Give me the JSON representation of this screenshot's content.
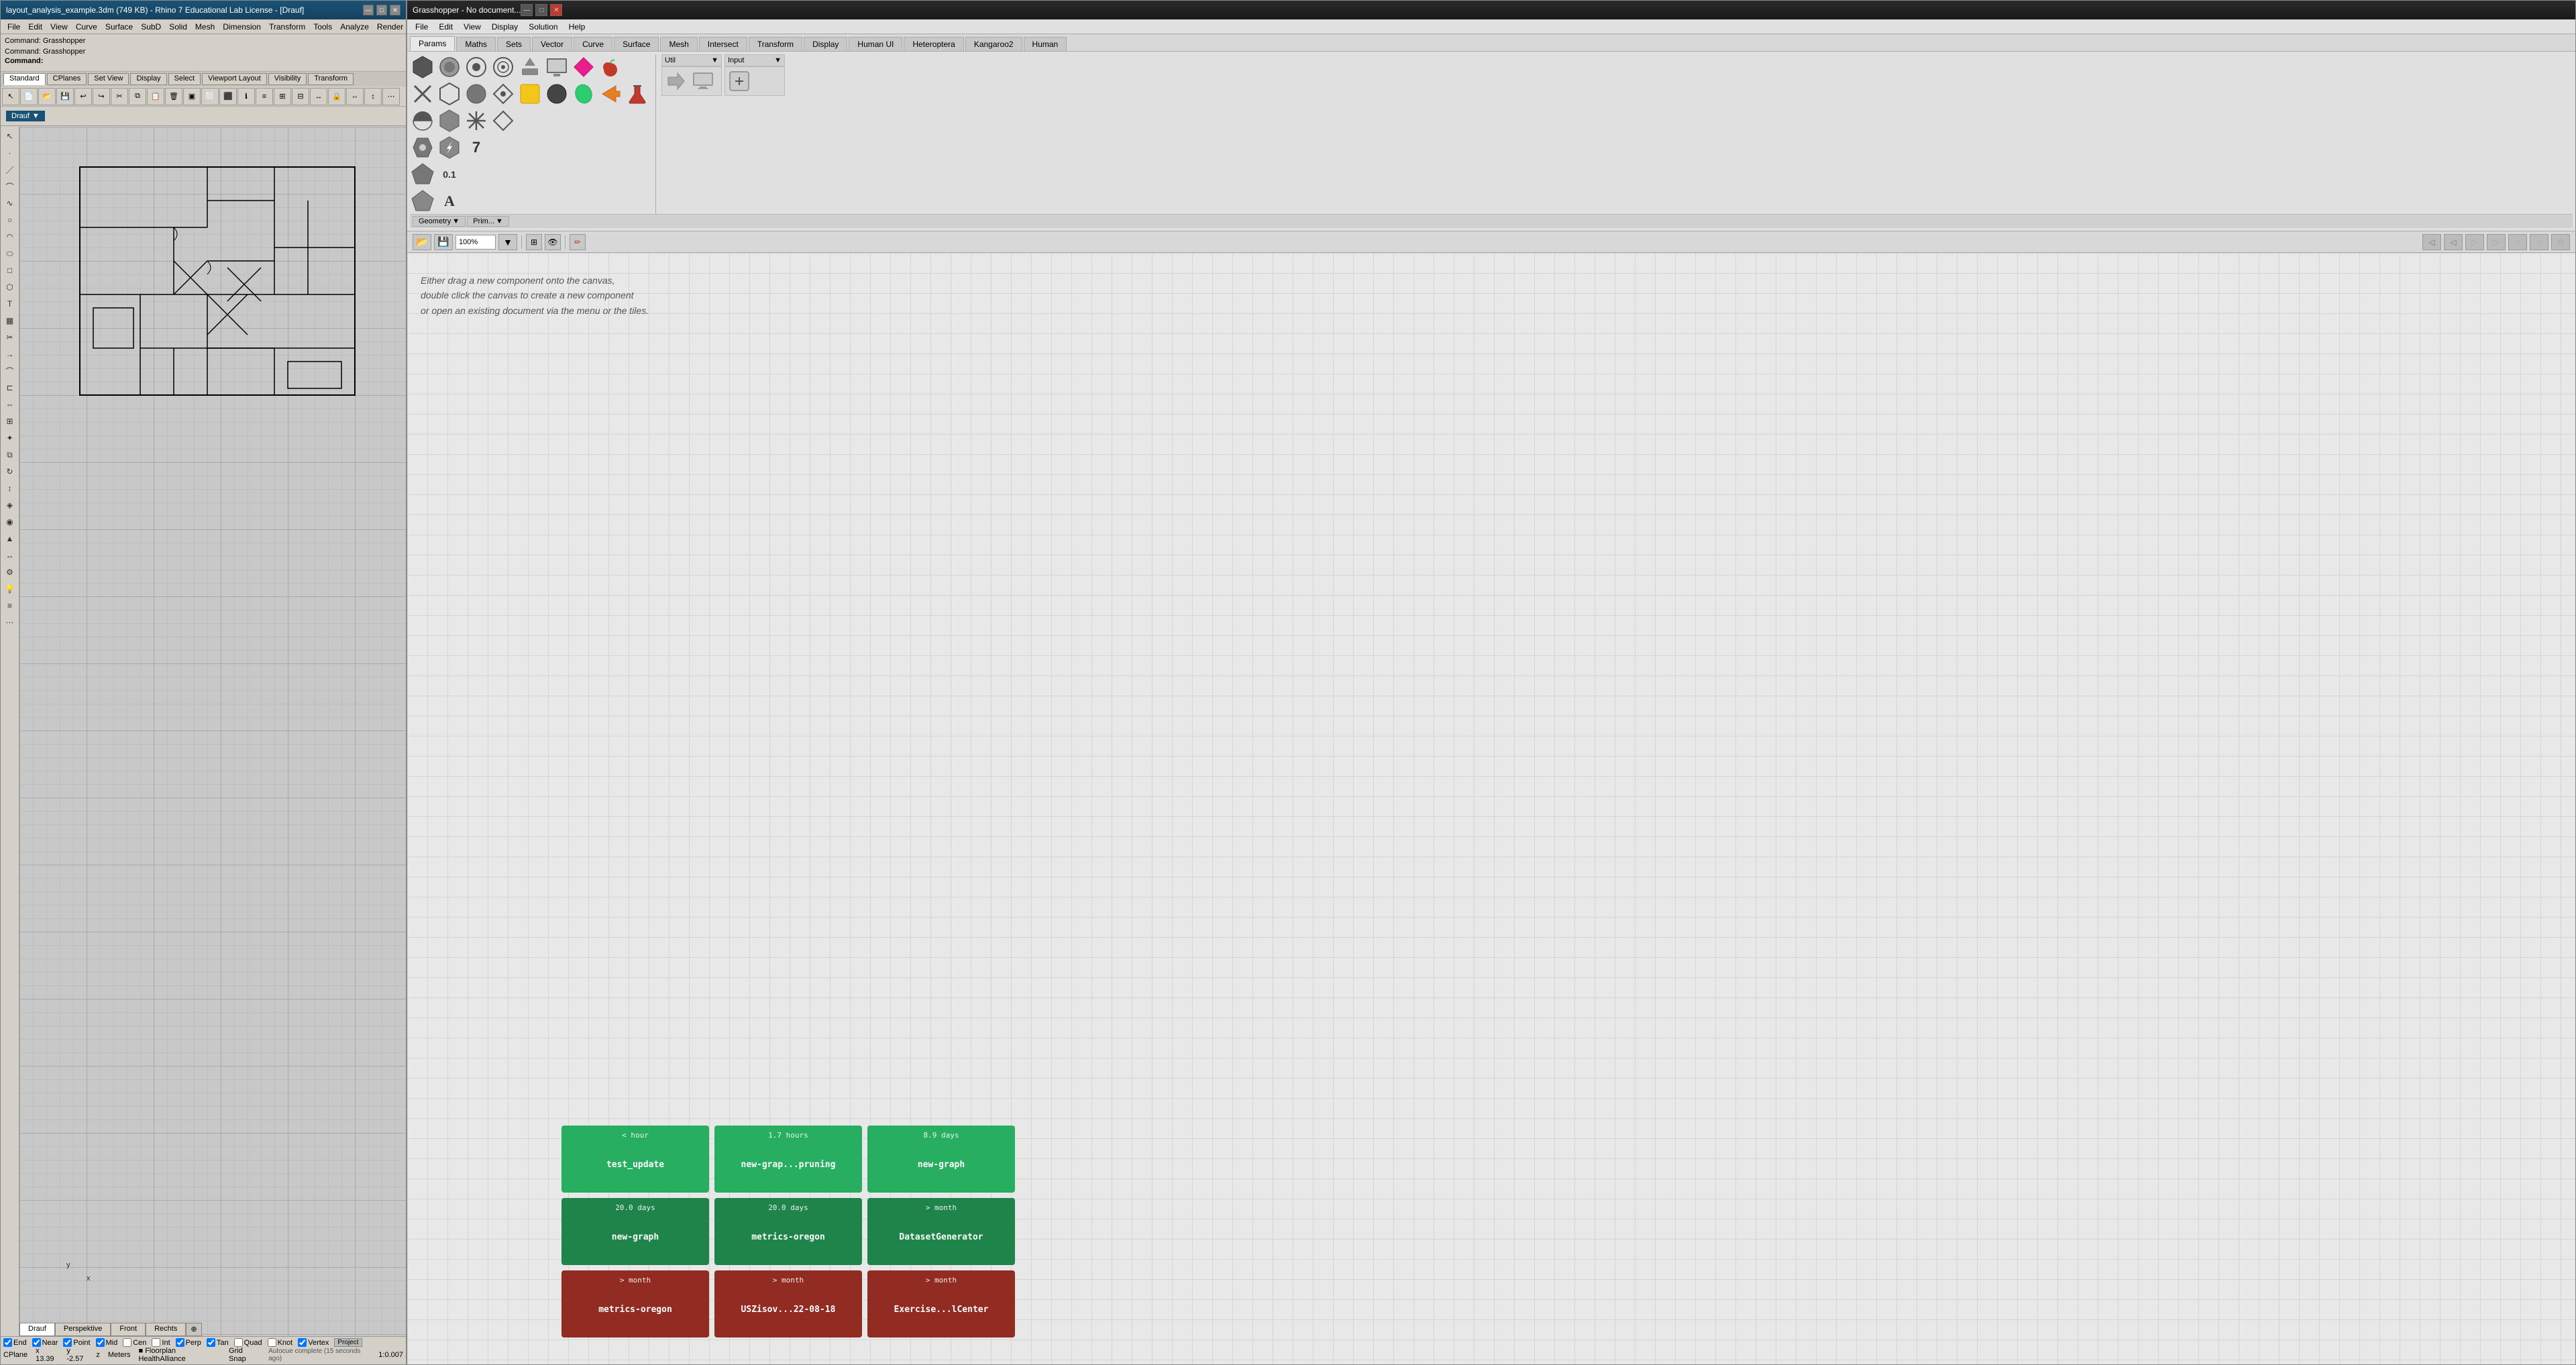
{
  "rhino": {
    "titlebar": {
      "title": "layout_analysis_example.3dm (749 KB) - Rhino 7 Educational Lab License - [Drauf]",
      "min_btn": "—",
      "max_btn": "□",
      "close_btn": "✕"
    },
    "menubar": {
      "items": [
        "File",
        "Edit",
        "View",
        "Curve",
        "Surface",
        "SubD",
        "Solid",
        "Mesh",
        "Dimension",
        "Transform",
        "Tools",
        "Analyze",
        "Render"
      ]
    },
    "commands": {
      "line1": "Command: Grasshopper",
      "line2": "Command: Grasshopper",
      "line3": "Command:"
    },
    "toolbar_tabs": {
      "items": [
        "Standard",
        "CPlanes",
        "Set View",
        "Display",
        "Select",
        "Viewport Layout",
        "Visibility",
        "Transform"
      ]
    },
    "viewport_label": "Drauf",
    "viewport_tabs": [
      "Drauf",
      "Perspektive",
      "Front",
      "Rechts"
    ],
    "statusbar": {
      "checkboxes": [
        "End",
        "Near",
        "Point",
        "Mid",
        "Cen",
        "Int",
        "Perp",
        "Tan",
        "Quad",
        "Knot",
        "Vertex"
      ],
      "checked": [
        "End",
        "Near",
        "Point",
        "Mid",
        "Perp",
        "Tan",
        "Vertex"
      ],
      "project": "Project",
      "layer": "Floorplan HealthAlliance",
      "coords": {
        "x": "x 13.39",
        "y": "y -2.57",
        "z": "z",
        "unit": "Meters"
      },
      "snap": "Grid Snap",
      "cplane": "CPlane",
      "autocue": "Autocue complete (15 seconds ago)",
      "scale": "1:0.007"
    },
    "axes": {
      "x": "x",
      "y": "y"
    }
  },
  "grasshopper": {
    "titlebar": {
      "title": "Grasshopper - No document...",
      "min_btn": "—",
      "max_btn": "□",
      "close_btn": "✕"
    },
    "menubar": {
      "items": [
        "File",
        "Edit",
        "View",
        "Display",
        "Solution",
        "Help"
      ]
    },
    "component_tabs": {
      "items": [
        "Params",
        "Maths",
        "Sets",
        "Vector",
        "Curve",
        "Surface",
        "Mesh",
        "Intersect",
        "Transform",
        "Display",
        "Human UI",
        "Heteroptera",
        "Kangaroo2",
        "Human"
      ],
      "active": "Params"
    },
    "params_panel": {
      "sections": {
        "main_icons_row1": [
          "⬡",
          "○",
          "○",
          "◉",
          "↑",
          "▣",
          "♦",
          "↗"
        ],
        "main_icons_row2": [
          "✕",
          "⬡",
          "○",
          "◈",
          "▣",
          "●",
          "⬡",
          "→",
          "⚗"
        ],
        "main_icons_row3": [
          "◐",
          "⬡",
          "✳",
          "◈"
        ],
        "main_icons_row4": [
          "⬟",
          "⬡",
          "7"
        ],
        "main_icons_row5": [
          "⬟",
          "0.1"
        ],
        "main_icons_row6": [
          "⬟",
          "A"
        ],
        "util_label": "Util",
        "input_label": "Input",
        "geometry_label": "Geometry",
        "prim_label": "Prim..."
      }
    },
    "canvas_toolbar": {
      "zoom_value": "100%",
      "zoom_placeholder": "100%"
    },
    "canvas": {
      "welcome_text": "Either drag a new component onto the canvas,\ndouble click the canvas to create a new component\nor open an existing document via the menu or the tiles."
    },
    "recent_files": {
      "rows": [
        [
          {
            "name": "test_update",
            "time": "< hour",
            "color": "green"
          },
          {
            "name": "new-grap...pruning",
            "time": "1.7 hours",
            "color": "green"
          },
          {
            "name": "new-graph",
            "time": "8.9 days",
            "color": "green"
          }
        ],
        [
          {
            "name": "new-graph",
            "time": "20.0 days",
            "color": "dark-green"
          },
          {
            "name": "metrics-oregon",
            "time": "20.0 days",
            "color": "dark-green"
          },
          {
            "name": "DatasetGenerator",
            "time": "> month",
            "color": "dark-green"
          }
        ],
        [
          {
            "name": "metrics-oregon",
            "time": "> month",
            "color": "red"
          },
          {
            "name": "USZisov...22-08-18",
            "time": "> month",
            "color": "red"
          },
          {
            "name": "Exercise...lCenter",
            "time": "> month",
            "color": "red"
          }
        ]
      ]
    }
  }
}
